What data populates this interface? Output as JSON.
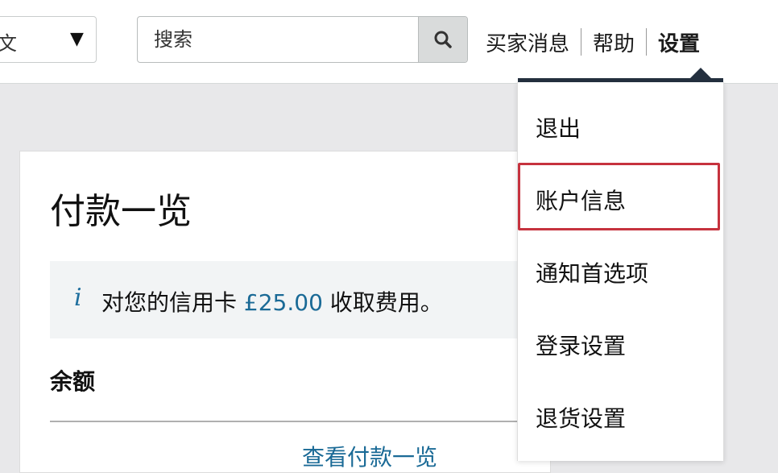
{
  "header": {
    "language_select": {
      "visible_text": "文",
      "caret": "▼"
    },
    "search": {
      "placeholder": "搜索",
      "button_icon": "search-icon"
    },
    "nav": {
      "buyer_messages": "买家消息",
      "help": "帮助",
      "settings": "设置"
    }
  },
  "settings_menu": {
    "items": [
      "退出",
      "账户信息",
      "通知首选项",
      "登录设置",
      "退货设置"
    ],
    "highlighted_item": "账户信息"
  },
  "payment_card": {
    "title": "付款一览",
    "alert": {
      "icon": "info-icon",
      "text_before": "对您的信用卡 ",
      "amount": "£25.00",
      "text_after": " 收取费用。"
    },
    "balance_label": "余额",
    "view_payments_link": "查看付款一览"
  },
  "colors": {
    "nav_dark": "#232f3e",
    "link_blue": "#1a6a96",
    "highlight_red": "#c6323e",
    "page_bg": "#e8e8ea"
  }
}
